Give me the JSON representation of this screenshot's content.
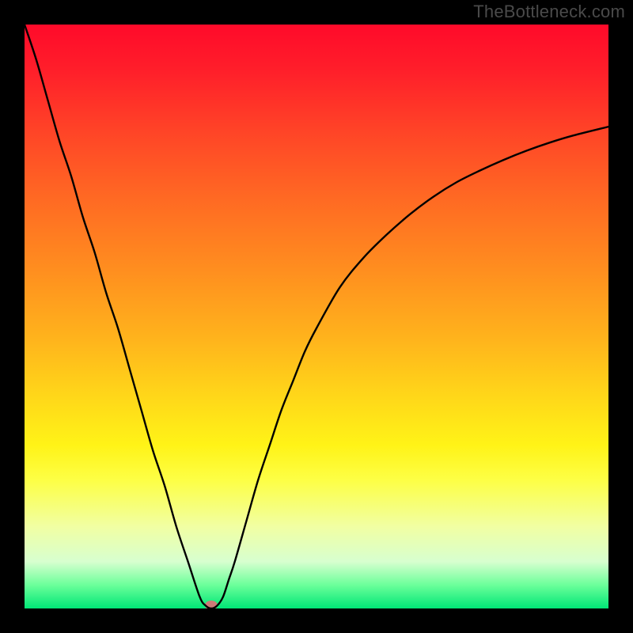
{
  "watermark": "TheBottleneck.com",
  "colors": {
    "frame_bg": "#000000",
    "curve_stroke": "#000000",
    "marker_fill": "#cd7a77",
    "gradient_top": "#ff0a2a",
    "gradient_bottom": "#00e676"
  },
  "chart_data": {
    "type": "line",
    "title": "",
    "xlabel": "",
    "ylabel": "",
    "xlim": [
      0,
      100
    ],
    "ylim": [
      0,
      100
    ],
    "grid": false,
    "legend": false,
    "x": [
      0,
      2,
      4,
      6,
      8,
      10,
      12,
      14,
      16,
      18,
      20,
      22,
      24,
      26,
      28,
      30,
      31,
      32,
      33,
      34,
      35,
      36,
      38,
      40,
      42,
      44,
      46,
      48,
      50,
      54,
      58,
      62,
      66,
      70,
      74,
      78,
      82,
      86,
      90,
      94,
      100
    ],
    "values": [
      100,
      94,
      87,
      80,
      74,
      67,
      61,
      54,
      48,
      41,
      34,
      27,
      21,
      14,
      8,
      2,
      0.5,
      0,
      0.5,
      2,
      5,
      8,
      15,
      22,
      28,
      34,
      39,
      44,
      48,
      55,
      60,
      64,
      67.5,
      70.5,
      73,
      75,
      76.8,
      78.4,
      79.8,
      81,
      82.5
    ],
    "marker": {
      "x": 32,
      "y": 0.5
    },
    "annotations": []
  }
}
